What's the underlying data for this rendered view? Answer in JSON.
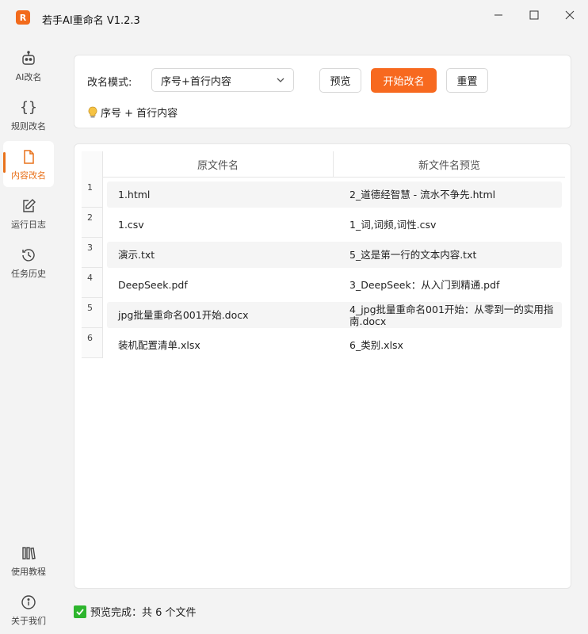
{
  "app": {
    "title": "若手AI重命名 V1.2.3",
    "logo_letter": "R"
  },
  "sidebar": {
    "items": [
      {
        "label": "AI改名",
        "icon": "robot-icon"
      },
      {
        "label": "规则改名",
        "icon": "braces-icon"
      },
      {
        "label": "内容改名",
        "icon": "file-icon",
        "active": true
      },
      {
        "label": "运行日志",
        "icon": "edit-icon"
      },
      {
        "label": "任务历史",
        "icon": "history-icon"
      }
    ],
    "bottom": [
      {
        "label": "使用教程",
        "icon": "books-icon"
      },
      {
        "label": "关于我们",
        "icon": "info-icon"
      }
    ]
  },
  "toolbar": {
    "mode_label": "改名模式:",
    "mode_value": "序号+首行内容",
    "preview_label": "预览",
    "start_label": "开始改名",
    "reset_label": "重置",
    "hint": "序号 + 首行内容"
  },
  "table": {
    "headers": [
      "原文件名",
      "新文件名预览"
    ],
    "rows": [
      {
        "num": "1",
        "orig": "1.html",
        "new": "2_道德经智慧 - 流水不争先.html"
      },
      {
        "num": "2",
        "orig": "1.csv",
        "new": "1_词,词频,词性.csv"
      },
      {
        "num": "3",
        "orig": "演示.txt",
        "new": "5_这是第一行的文本内容.txt"
      },
      {
        "num": "4",
        "orig": "DeepSeek.pdf",
        "new": "3_DeepSeek：从入门到精通.pdf"
      },
      {
        "num": "5",
        "orig": "jpg批量重命名001开始.docx",
        "new": "4_jpg批量重命名001开始：从零到一的实用指南.docx"
      },
      {
        "num": "6",
        "orig": "装机配置清单.xlsx",
        "new": "6_类别.xlsx"
      }
    ]
  },
  "status": {
    "text": "预览完成：共 6 个文件"
  },
  "colors": {
    "accent": "#f7691f",
    "success": "#2db52d"
  }
}
